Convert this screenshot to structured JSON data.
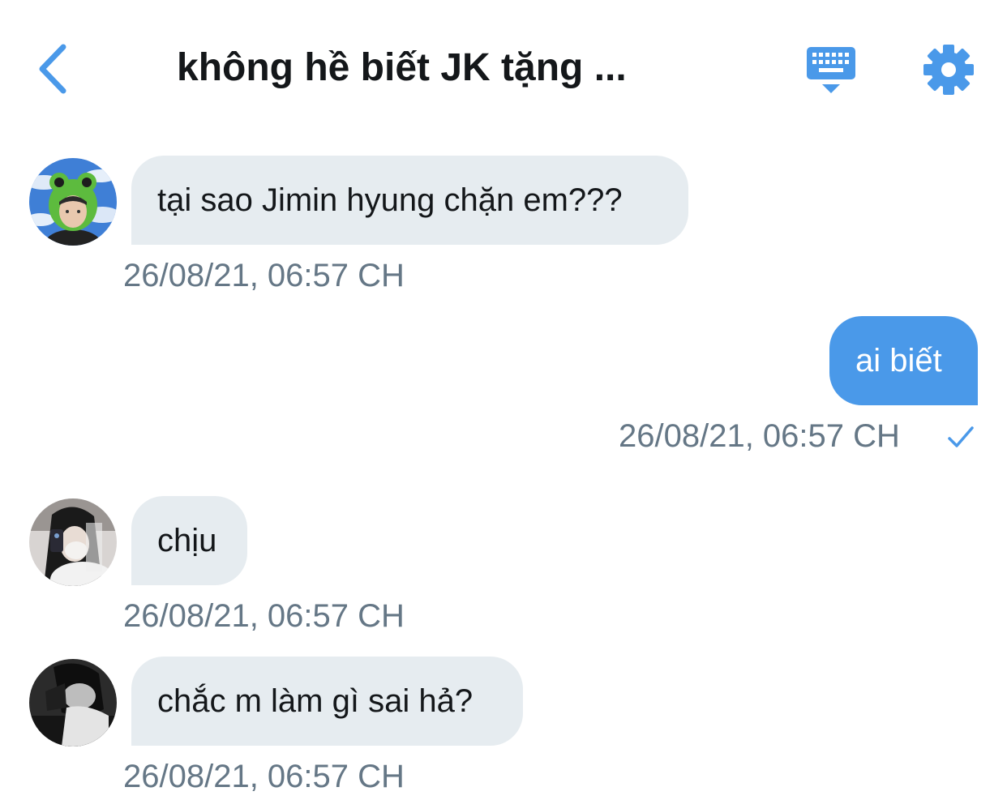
{
  "header": {
    "title": "không hề biết JK tặng ...",
    "back_icon": "chevron-left-icon",
    "keyboard_icon": "keyboard-icon",
    "settings_icon": "gear-icon",
    "accent_color": "#4a99e9"
  },
  "messages": [
    {
      "direction": "incoming",
      "text": "tại sao Jimin hyung chặn em???",
      "timestamp": "26/08/21, 06:57 CH",
      "avatar": "frog-hat-avatar"
    },
    {
      "direction": "outgoing",
      "text": "ai biết",
      "timestamp": "26/08/21, 06:57 CH",
      "status_icon": "check-icon"
    },
    {
      "direction": "incoming",
      "text": "chịu",
      "timestamp": "26/08/21, 06:57 CH",
      "avatar": "masked-selfie-avatar"
    },
    {
      "direction": "incoming",
      "text": "chắc m làm gì sai hả?",
      "timestamp": "26/08/21, 06:57 CH",
      "avatar": "bw-avatar"
    }
  ],
  "colors": {
    "incoming_bubble": "#e6ecf0",
    "outgoing_bubble": "#4a99e9",
    "timestamp": "#657786"
  }
}
